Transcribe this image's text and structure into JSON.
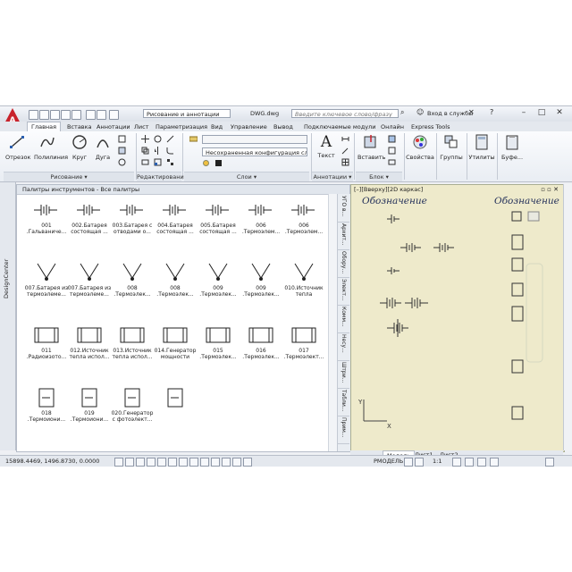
{
  "title_bar": {
    "workspace": "Рисование и аннотации",
    "filename": "DWG.dwg",
    "search_placeholder": "Введите ключевое слово/фразу",
    "signin": "Вход в службы"
  },
  "ribbon_tabs": [
    "Главная",
    "Вставка",
    "Аннотации",
    "Лист",
    "Параметризация",
    "Вид",
    "Управление",
    "Вывод",
    "Подключаемые модули",
    "Онлайн",
    "Express Tools"
  ],
  "ribbon": {
    "tools": [
      "Отрезок",
      "Полилиния",
      "Круг",
      "Дуга"
    ],
    "layer_state": "Несохраненная конфигурация сло",
    "text_btn": "Текст",
    "insert_btn": "Вставить",
    "props_btn": "Свойства",
    "groups_btn": "Группы",
    "utils_btn": "Утилиты",
    "buffer_btn": "Буфе...",
    "panels": [
      "Рисование ▾",
      "Редактирование ▾",
      "Слои ▾",
      "Аннотации ▾",
      "Блок ▾"
    ]
  },
  "left_strip": "DesignCenter",
  "palette": {
    "header": "Палитры инструментов - Все палитры",
    "items": [
      "001\n.Гальваниче...",
      "002.Батарея\nсостоящая ...",
      "003.Батарея с\nотводами о...",
      "004.Батарея\nсостоящая ...",
      "005.Батарея\nсостоящая ...",
      "006\n.Термоэлем...",
      "006\n.Термоэлем...",
      "007.Батарея из\nтермоэлеме...",
      "007.Батарея из\nтермоэлеме...",
      "008\n.Термоэлек...",
      "008\n.Термоэлек...",
      "009\n.Термоэлек...",
      "009\n.Термоэлек...",
      "010.Источник\nтепла",
      "011\n.Радиоизото...",
      "012.Источник\nтепла испол...",
      "013.Источник\nтепла испол...",
      "014.Генератор\nмощности",
      "015\n.Термоэлек...",
      "016\n.Термоэлек...",
      "017\n.Термоэлект...",
      "018\n.Термоиони...",
      "019\n.Термоиони...",
      "020.Генератор\nс фотоэлект..."
    ],
    "side_tabs": [
      "УГО в...",
      "Архит...",
      "Обору...",
      "Элект...",
      "Комм...",
      "Несу...",
      "Штри...",
      "Табли...",
      "Прим..."
    ]
  },
  "drawing": {
    "viewport_label": "[–][Вверху][2D каркас]",
    "title_left": "Обозначение",
    "title_right": "Обозначение"
  },
  "layout_tabs": [
    "Модель",
    "Лист1",
    "Лист2"
  ],
  "status": {
    "coords": "15898.4469, 1496.8730, 0.0000",
    "model": "PМОДЕЛЬ",
    "scale": "1:1"
  },
  "colors": {
    "accent": "#c8232c",
    "drawing_bg": "#eeeacb",
    "title_text": "#23305a"
  }
}
